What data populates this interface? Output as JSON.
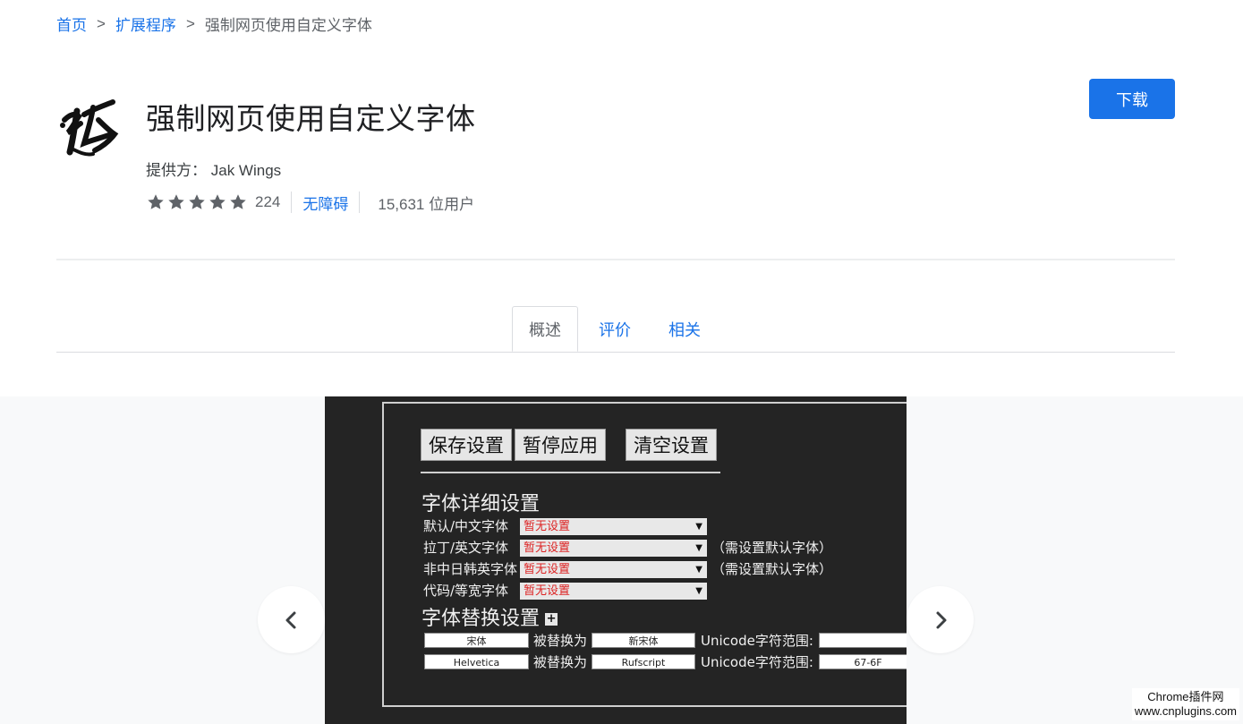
{
  "breadcrumb": {
    "home": "首页",
    "extensions": "扩展程序",
    "current": "强制网页使用自定义字体",
    "separator": ">"
  },
  "extension": {
    "name": "强制网页使用自定义字体",
    "provider_label": "提供方：",
    "provider_name": "Jak Wings",
    "rating_stars": 5,
    "rating_count": "224",
    "accessibility_link": "无障碍",
    "users": "15,631 位用户"
  },
  "actions": {
    "download_label": "下载"
  },
  "tabs": [
    {
      "label": "概述",
      "active": true
    },
    {
      "label": "评价",
      "active": false
    },
    {
      "label": "相关",
      "active": false
    }
  ],
  "gallery": {
    "screenshot": {
      "buttons": [
        "保存设置",
        "暂停应用",
        "清空设置"
      ],
      "section_detail": "字体详细设置",
      "font_rows": [
        {
          "label": "默认/中文字体",
          "value": "暂无设置",
          "note": ""
        },
        {
          "label": "拉丁/英文字体",
          "value": "暂无设置",
          "note": "（需设置默认字体）"
        },
        {
          "label": "非中日韩英字体",
          "value": "暂无设置",
          "note": "（需设置默认字体）"
        },
        {
          "label": "代码/等宽字体",
          "value": "暂无设置",
          "note": ""
        }
      ],
      "section_replace": "字体替换设置",
      "add_symbol": "+",
      "replace_rows": [
        {
          "from": "宋体",
          "middle": "被替换为",
          "to": "新宋体",
          "range_label": "Unicode字符范围:",
          "range": ""
        },
        {
          "from": "Helvetica",
          "middle": "被替换为",
          "to": "Rufscript",
          "range_label": "Unicode字符范围:",
          "range": "67-6F"
        }
      ]
    }
  },
  "watermark": {
    "line1": "Chrome插件网",
    "line2": "www.cnplugins.com"
  },
  "colors": {
    "accent": "#1a73e8",
    "star": "#5f6368",
    "gallery_bg": "#f8f9fa"
  }
}
